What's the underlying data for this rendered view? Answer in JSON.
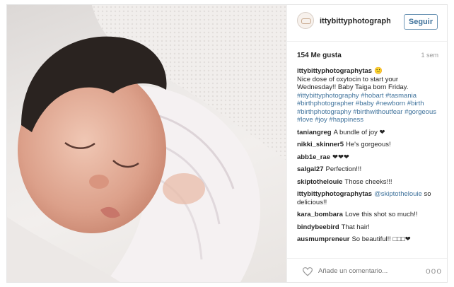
{
  "post": {
    "author": "ittybittyphotography...",
    "follow_label": "Seguir",
    "likes": "154 Me gusta",
    "age": "1 sem",
    "caption_user": "ittybittyphotographytas",
    "caption_emoji": "🙂",
    "caption_text": "Nice dose of oxytocin to start your Wednesday!! Baby Taiga born Friday.",
    "caption_tags": "#ittybittyphotography #hobart #tasmania #birthphotographer #baby #newborn #birth #birthphotography #birthwithoutfear #gorgeous #love #joy #happiness"
  },
  "comments": [
    {
      "user": "taniangreg",
      "text": "A bundle of joy ❤"
    },
    {
      "user": "nikki_skinner5",
      "text": "He's gorgeous!"
    },
    {
      "user": "abb1e_rae",
      "text": "❤❤❤"
    },
    {
      "user": "salgal27",
      "text": "Perfection!!!"
    },
    {
      "user": "skiptothelouie",
      "text": "Those cheeks!!!"
    },
    {
      "user": "ittybittyphotographytas",
      "mention": "@skiptothelouie",
      "text": "so delicious!!"
    },
    {
      "user": "kara_bombara",
      "text": "Love this shot so much!!"
    },
    {
      "user": "bindybeebird",
      "text": "That hair!"
    },
    {
      "user": "ausmumpreneur",
      "text": "So beautiful!! □□□❤"
    }
  ],
  "footer": {
    "comment_placeholder": "Añade un comentario...",
    "more_label": "ooo"
  },
  "icons": {
    "like": "heart-outline-icon",
    "more": "more-options-icon",
    "avatar": "profile-avatar"
  }
}
